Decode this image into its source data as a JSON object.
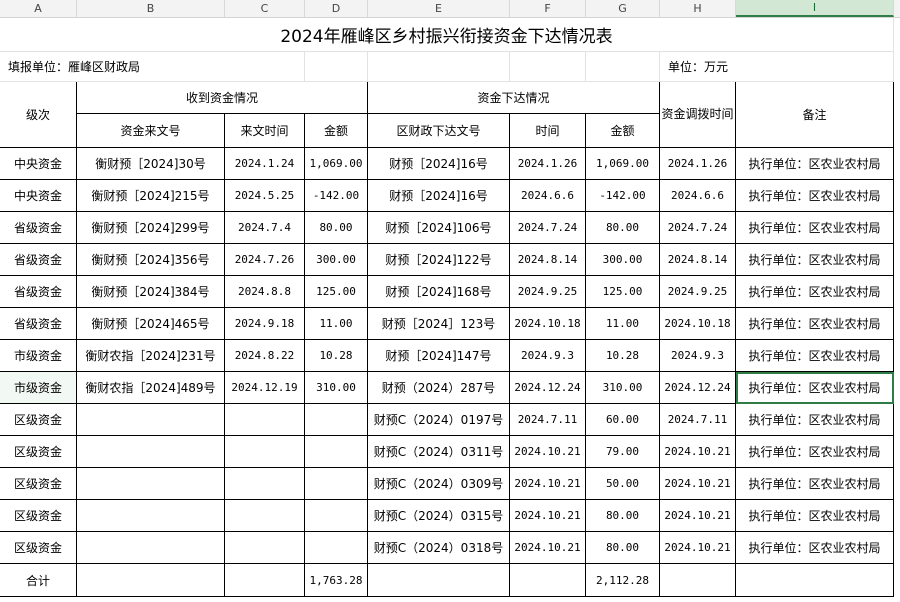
{
  "column_headers": [
    "A",
    "B",
    "C",
    "D",
    "E",
    "F",
    "G",
    "H",
    "I"
  ],
  "selected_column": "I",
  "sheet": {
    "title": "2024年雁峰区乡村振兴衔接资金下达情况表",
    "filler": "填报单位：雁峰区财政局",
    "unit": "单位：万元",
    "headers": {
      "level": "级次",
      "received_group": "收到资金情况",
      "source_doc": "资金来文号",
      "source_date": "来文时间",
      "source_amount": "金额",
      "allocated_group": "资金下达情况",
      "alloc_doc": "区财政下达文号",
      "alloc_date": "时间",
      "alloc_amount": "金额",
      "transfer_time": "资金调拨时间",
      "remark": "备注"
    },
    "rows": [
      {
        "level": "中央资金",
        "src_doc": "衡财预［2024]30号",
        "src_date": "2024.1.24",
        "src_amt": "1,069.00",
        "alloc_doc": "财预［2024]16号",
        "alloc_date": "2024.1.26",
        "alloc_amt": "1,069.00",
        "transfer": "2024.1.26",
        "remark": "执行单位：区农业农村局"
      },
      {
        "level": "中央资金",
        "src_doc": "衡财预［2024]215号",
        "src_date": "2024.5.25",
        "src_amt": "-142.00",
        "alloc_doc": "财预［2024]16号",
        "alloc_date": "2024.6.6",
        "alloc_amt": "-142.00",
        "transfer": "2024.6.6",
        "remark": "执行单位：区农业农村局"
      },
      {
        "level": "省级资金",
        "src_doc": "衡财预［2024]299号",
        "src_date": "2024.7.4",
        "src_amt": "80.00",
        "alloc_doc": "财预［2024]106号",
        "alloc_date": "2024.7.24",
        "alloc_amt": "80.00",
        "transfer": "2024.7.24",
        "remark": "执行单位：区农业农村局"
      },
      {
        "level": "省级资金",
        "src_doc": "衡财预［2024]356号",
        "src_date": "2024.7.26",
        "src_amt": "300.00",
        "alloc_doc": "财预［2024]122号",
        "alloc_date": "2024.8.14",
        "alloc_amt": "300.00",
        "transfer": "2024.8.14",
        "remark": "执行单位：区农业农村局"
      },
      {
        "level": "省级资金",
        "src_doc": "衡财预［2024]384号",
        "src_date": "2024.8.8",
        "src_amt": "125.00",
        "alloc_doc": "财预［2024]168号",
        "alloc_date": "2024.9.25",
        "alloc_amt": "125.00",
        "transfer": "2024.9.25",
        "remark": "执行单位：区农业农村局"
      },
      {
        "level": "省级资金",
        "src_doc": "衡财预［2024]465号",
        "src_date": "2024.9.18",
        "src_amt": "11.00",
        "alloc_doc": "财预［2024］123号",
        "alloc_date": "2024.10.18",
        "alloc_amt": "11.00",
        "transfer": "2024.10.18",
        "remark": "执行单位：区农业农村局"
      },
      {
        "level": "市级资金",
        "src_doc": "衡财农指［2024]231号",
        "src_date": "2024.8.22",
        "src_amt": "10.28",
        "alloc_doc": "财预［2024]147号",
        "alloc_date": "2024.9.3",
        "alloc_amt": "10.28",
        "transfer": "2024.9.3",
        "remark": "执行单位：区农业农村局"
      },
      {
        "level": "市级资金",
        "src_doc": "衡财农指［2024]489号",
        "src_date": "2024.12.19",
        "src_amt": "310.00",
        "alloc_doc": "财预（2024）287号",
        "alloc_date": "2024.12.24",
        "alloc_amt": "310.00",
        "transfer": "2024.12.24",
        "remark": "执行单位：区农业农村局"
      },
      {
        "level": "区级资金",
        "src_doc": "",
        "src_date": "",
        "src_amt": "",
        "alloc_doc": "财预C（2024）0197号",
        "alloc_date": "2024.7.11",
        "alloc_amt": "60.00",
        "transfer": "2024.7.11",
        "remark": "执行单位：区农业农村局"
      },
      {
        "level": "区级资金",
        "src_doc": "",
        "src_date": "",
        "src_amt": "",
        "alloc_doc": "财预C（2024）0311号",
        "alloc_date": "2024.10.21",
        "alloc_amt": "79.00",
        "transfer": "2024.10.21",
        "remark": "执行单位：区农业农村局"
      },
      {
        "level": "区级资金",
        "src_doc": "",
        "src_date": "",
        "src_amt": "",
        "alloc_doc": "财预C（2024）0309号",
        "alloc_date": "2024.10.21",
        "alloc_amt": "50.00",
        "transfer": "2024.10.21",
        "remark": "执行单位：区农业农村局"
      },
      {
        "level": "区级资金",
        "src_doc": "",
        "src_date": "",
        "src_amt": "",
        "alloc_doc": "财预C（2024）0315号",
        "alloc_date": "2024.10.21",
        "alloc_amt": "80.00",
        "transfer": "2024.10.21",
        "remark": "执行单位：区农业农村局"
      },
      {
        "level": "区级资金",
        "src_doc": "",
        "src_date": "",
        "src_amt": "",
        "alloc_doc": "财预C（2024）0318号",
        "alloc_date": "2024.10.21",
        "alloc_amt": "80.00",
        "transfer": "2024.10.21",
        "remark": "执行单位：区农业农村局"
      }
    ],
    "total": {
      "label": "合计",
      "src_amt": "1,763.28",
      "alloc_amt": "2,112.28"
    }
  },
  "colors": {
    "selection": "#2e7d46",
    "header_bg": "#f3f3f3"
  }
}
